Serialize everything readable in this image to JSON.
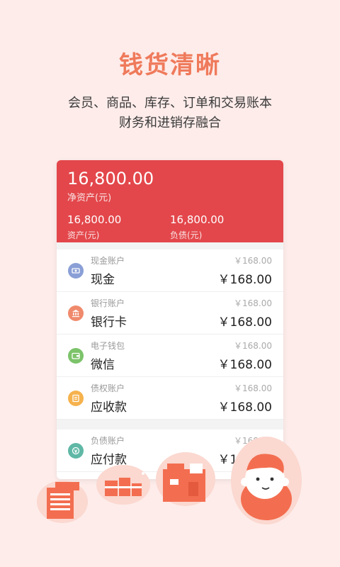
{
  "hero": {
    "title": "钱货清晰",
    "subtitle_line1": "会员、商品、库存、订单和交易账本",
    "subtitle_line2": "财务和进销存融合"
  },
  "summary": {
    "net_assets_value": "16,800.00",
    "net_assets_label": "净资产(元)",
    "assets_value": "16,800.00",
    "assets_label": "资产(元)",
    "liabilities_value": "16,800.00",
    "liabilities_label": "负债(元)"
  },
  "accounts": [
    {
      "type": "现金账户",
      "name": "现金",
      "small_amount": "￥168.00",
      "amount": "￥168.00",
      "icon": "cash-icon",
      "color": "#8a9fd6"
    },
    {
      "type": "银行账户",
      "name": "银行卡",
      "small_amount": "￥168.00",
      "amount": "￥168.00",
      "icon": "bank-icon",
      "color": "#f08a6c"
    },
    {
      "type": "电子钱包",
      "name": "微信",
      "small_amount": "￥168.00",
      "amount": "￥168.00",
      "icon": "wallet-icon",
      "color": "#7cc36a"
    },
    {
      "type": "债权账户",
      "name": "应收款",
      "small_amount": "￥168.00",
      "amount": "￥168.00",
      "icon": "receivable-icon",
      "color": "#f6b24d"
    }
  ],
  "liability_accounts": [
    {
      "type": "负债账户",
      "name": "应付款",
      "small_amount": "￥168.00",
      "amount": "￥168.00",
      "icon": "payable-icon",
      "color": "#5fb8a6"
    }
  ],
  "colors": {
    "background": "#fdecea",
    "accent": "#e3474b",
    "title": "#ef7a5b"
  }
}
